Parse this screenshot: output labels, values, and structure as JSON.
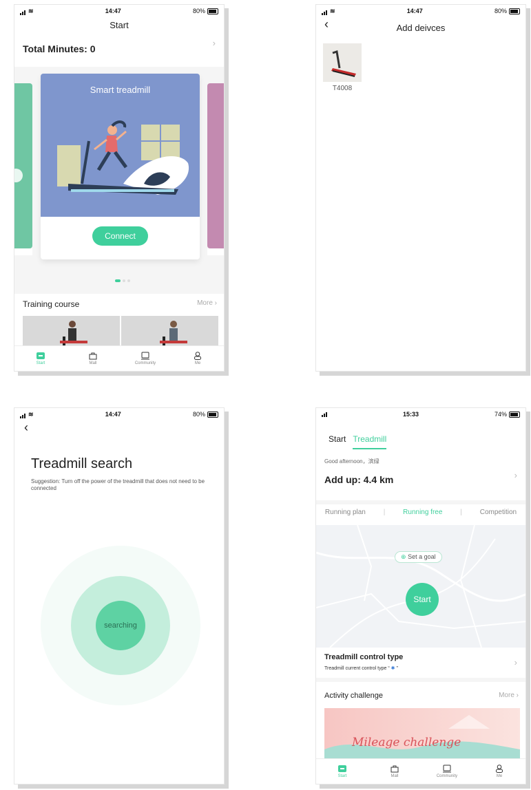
{
  "screen1": {
    "status": {
      "time": "14:47",
      "battery": "80%"
    },
    "title": "Start",
    "total_minutes": "Total Minutes: 0",
    "card_title": "Smart treadmill",
    "connect": "Connect",
    "training_title": "Training course",
    "more": "More",
    "tabs": [
      {
        "label": "Start"
      },
      {
        "label": "Mall"
      },
      {
        "label": "Community"
      },
      {
        "label": "Me"
      }
    ]
  },
  "screen2": {
    "status": {
      "time": "14:47",
      "battery": "80%"
    },
    "title": "Add deivces",
    "device_name": "T4008"
  },
  "screen3": {
    "status": {
      "time": "14:47",
      "battery": "80%"
    },
    "title": "Treadmill search",
    "suggestion": "Suggestion: Turn off the power of the treadmill that does not need to be connected",
    "searching": "searching"
  },
  "screen4": {
    "status": {
      "time": "15:33",
      "battery": "74%"
    },
    "top_tabs": [
      {
        "label": "Start"
      },
      {
        "label": "Treadmill"
      }
    ],
    "greeting": "Good afternoon，滨绿",
    "add_up": "Add up: 4.4 km",
    "modes": [
      {
        "label": "Running plan"
      },
      {
        "label": "Running free"
      },
      {
        "label": "Competition"
      }
    ],
    "set_goal": "Set a goal",
    "start": "Start",
    "control_title": "Treadmill control type",
    "control_sub_pre": "Treadmill current control type “",
    "control_sub_post": "”",
    "activity_title": "Activity challenge",
    "more": "More",
    "banner": "Mileage challenge",
    "tabs": [
      {
        "label": "Start"
      },
      {
        "label": "Mall"
      },
      {
        "label": "Community"
      },
      {
        "label": "Me"
      }
    ]
  },
  "colors": {
    "accent": "#3fcf9c",
    "card_blue": "#7f96cd",
    "card_green": "#6fc6a3",
    "card_pink": "#c38ab0"
  }
}
